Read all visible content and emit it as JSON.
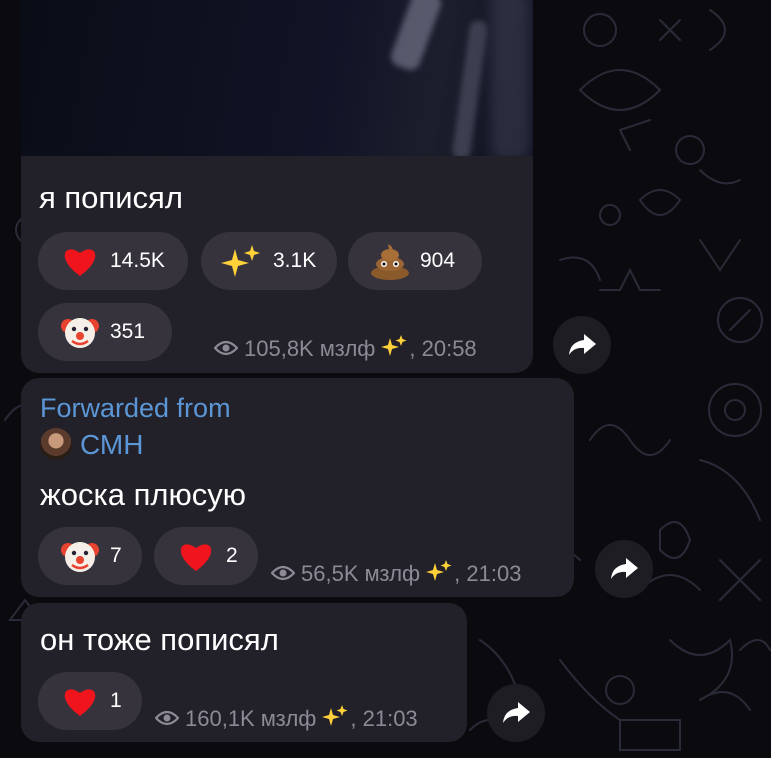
{
  "messages": [
    {
      "text": "я пописял",
      "reactions": [
        {
          "icon": "heart-emoji",
          "count": "14.5K"
        },
        {
          "icon": "sparkles-emoji",
          "count": "3.1K"
        },
        {
          "icon": "poop-emoji",
          "count": "904"
        },
        {
          "icon": "clown-emoji",
          "count": "351"
        }
      ],
      "views": "105,8K",
      "author": "мзлф",
      "time": ", 20:58"
    },
    {
      "forwarded_label": "Forwarded from",
      "forwarded_from": "СМН",
      "text": "жоска плюсую",
      "reactions": [
        {
          "icon": "clown-emoji",
          "count": "7"
        },
        {
          "icon": "heart-emoji",
          "count": "2"
        }
      ],
      "views": "56,5K",
      "author": "мзлф",
      "time": ", 21:03"
    },
    {
      "text": "он тоже пописял",
      "reactions": [
        {
          "icon": "heart-emoji",
          "count": "1"
        }
      ],
      "views": "160,1K",
      "author": "мзлф",
      "time": ", 21:03"
    }
  ],
  "colors": {
    "background": "#0b0b0f",
    "bubble": "#222028",
    "chip": "#36333d",
    "link": "#5b96d6",
    "meta": "#8d8a96"
  }
}
